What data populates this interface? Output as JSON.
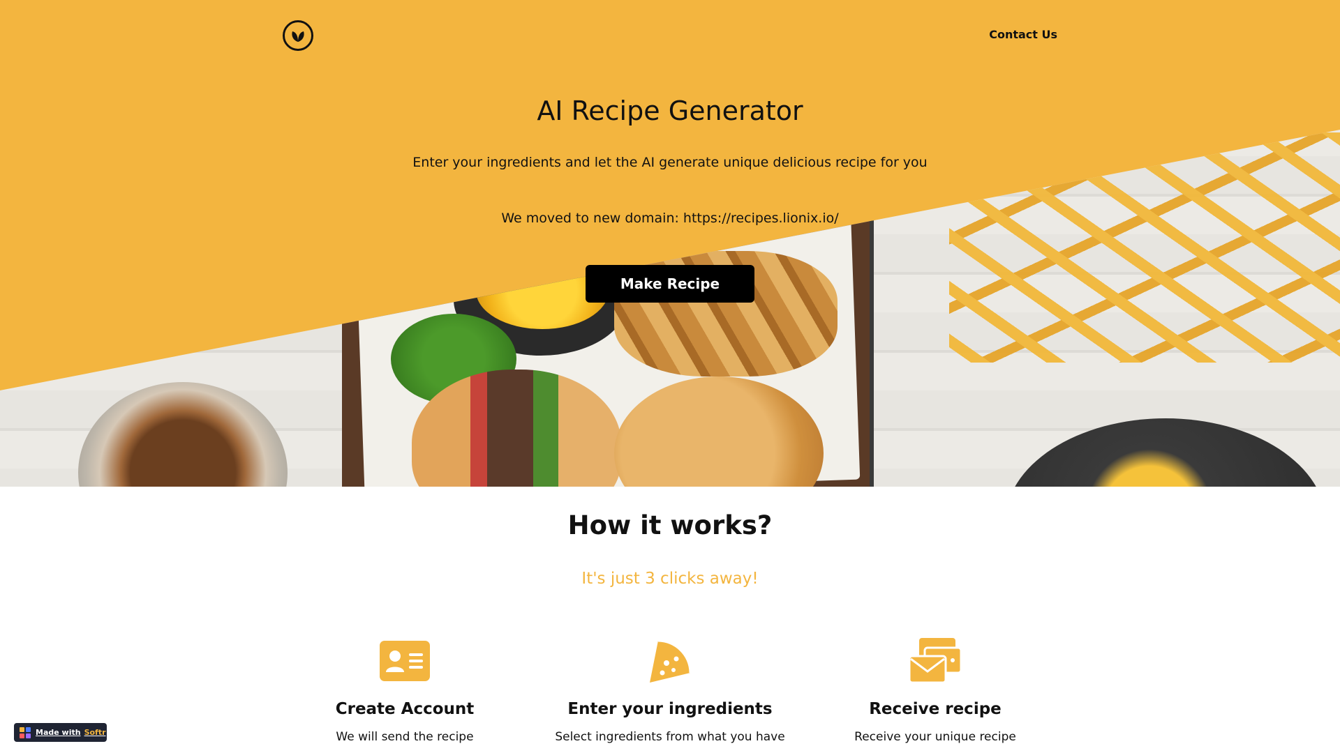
{
  "header": {
    "logo_icon": "leaf-icon",
    "contact_label": "Contact Us"
  },
  "hero": {
    "title": "AI Recipe Generator",
    "subtitle": "Enter your ingredients and let the AI generate unique delicious recipe for you",
    "domain_notice": "We moved to new domain: https://recipes.lionix.io/",
    "cta_label": "Make Recipe",
    "accent_color": "#f3b53f"
  },
  "how": {
    "title": "How it works?",
    "subtitle": "It's just 3 clicks away!",
    "steps": [
      {
        "icon": "id-card-icon",
        "title": "Create Account",
        "text": "We will send the recipe"
      },
      {
        "icon": "pizza-slice-icon",
        "title": "Enter your ingredients",
        "text": "Select ingredients from what you have"
      },
      {
        "icon": "envelopes-icon",
        "title": "Receive recipe",
        "text": "Receive your unique recipe"
      }
    ]
  },
  "badge": {
    "prefix": "Made with",
    "brand": "Softr"
  }
}
